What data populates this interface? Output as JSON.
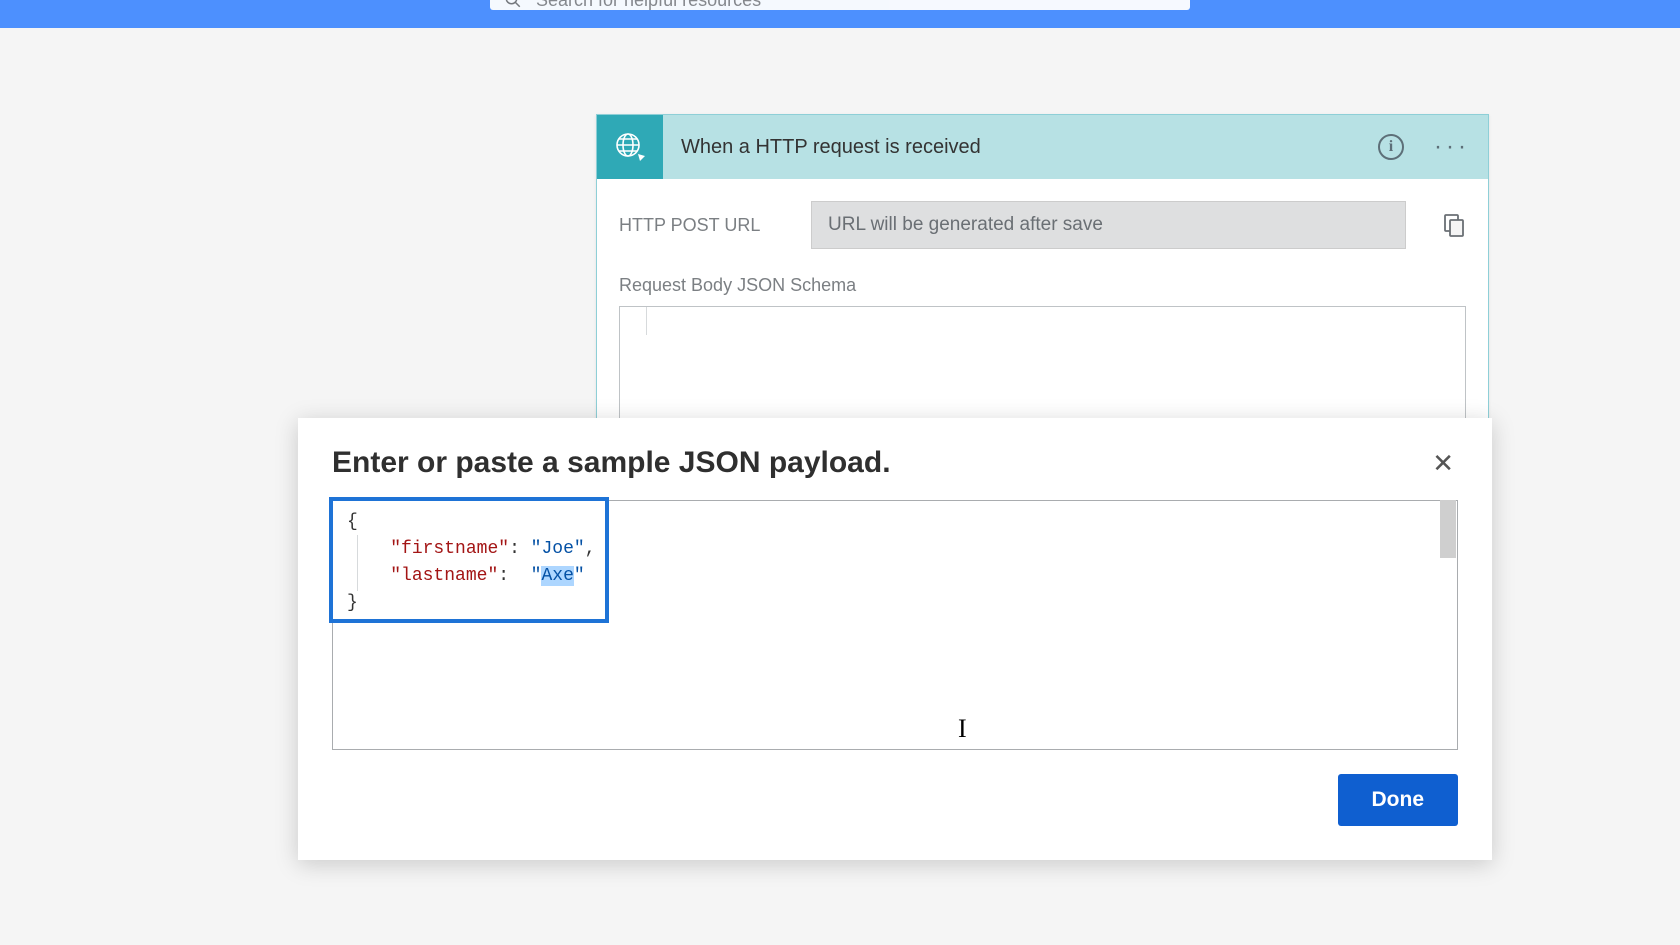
{
  "search": {
    "placeholder": "Search for helpful resources"
  },
  "trigger": {
    "title": "When a HTTP request is received",
    "url_label": "HTTP POST URL",
    "url_placeholder": "URL will be generated after save",
    "schema_label": "Request Body JSON Schema"
  },
  "dialog": {
    "title": "Enter or paste a sample JSON payload.",
    "done_label": "Done",
    "json_sample": {
      "key1": "firstname",
      "val1": "Joe",
      "key2": "lastname",
      "val2": "Axe"
    }
  }
}
